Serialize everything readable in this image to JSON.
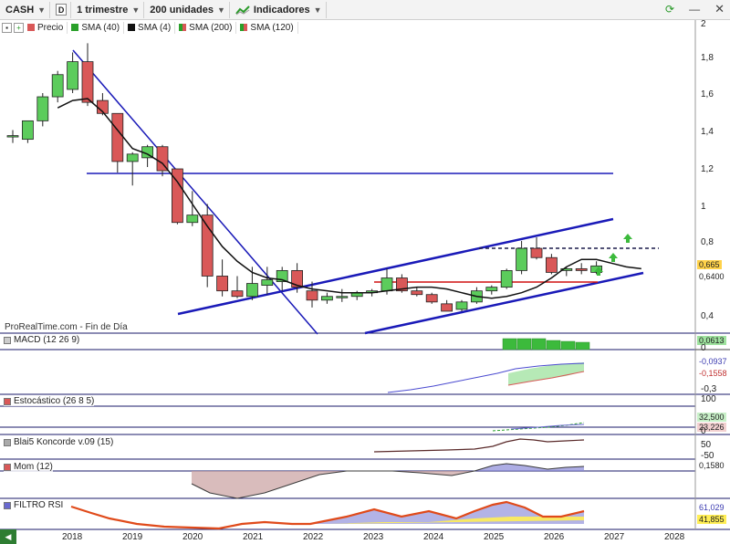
{
  "toolbar": {
    "ticker": "CASH",
    "period_box": "D",
    "timeframe": "1 trimestre",
    "units": "200 unidades",
    "indicators": "Indicadores"
  },
  "legend": {
    "price": "Precio",
    "sma40": "SMA (40)",
    "sma4": "SMA (4)",
    "sma200": "SMA (200)",
    "sma120": "SMA (120)"
  },
  "watermark": "ProRealTime.com - Fin de Día",
  "panels": {
    "macd": "MACD (12 26 9)",
    "stoch": "Estocástico (26 8 5)",
    "koncorde": "Blai5 Koncorde v.09 (15)",
    "mom": "Mom (12)",
    "rsi": "FILTRO RSI"
  },
  "price_axis": [
    "2",
    "1,8",
    "1,6",
    "1,4",
    "1,2",
    "1",
    "0,8",
    "0,4"
  ],
  "price_tags": {
    "last": "0,665",
    "sma": "0,6400"
  },
  "macd_axis": {
    "tag1": "0,0613",
    "v1": "0",
    "tag2": "-0,0937",
    "tag3": "-0,1558",
    "v2": "-0,3"
  },
  "stoch_axis": {
    "v1": "100",
    "tag1": "32,500",
    "tag2": "23,226",
    "v2": "0"
  },
  "koncorde_axis": {
    "v1": "50",
    "v2": "-50"
  },
  "mom_axis": {
    "tag1": "0,1580"
  },
  "rsi_axis": {
    "tag1": "61,029",
    "tag2": "41,855"
  },
  "years": [
    "2018",
    "2019",
    "2020",
    "2021",
    "2022",
    "2023",
    "2024",
    "2025",
    "2026",
    "2027",
    "2028"
  ],
  "colors": {
    "up": "#5ccc5c",
    "down": "#d95858",
    "trend": "#1a1ab8",
    "support": "#d01010"
  },
  "candles": [
    {
      "o": 1.37,
      "h": 1.4,
      "l": 1.33,
      "c": 1.37
    },
    {
      "o": 1.35,
      "h": 1.45,
      "l": 1.33,
      "c": 1.45
    },
    {
      "o": 1.45,
      "h": 1.6,
      "l": 1.42,
      "c": 1.58
    },
    {
      "o": 1.58,
      "h": 1.72,
      "l": 1.55,
      "c": 1.7
    },
    {
      "o": 1.62,
      "h": 1.82,
      "l": 1.6,
      "c": 1.77
    },
    {
      "o": 1.77,
      "h": 1.87,
      "l": 1.53,
      "c": 1.55
    },
    {
      "o": 1.56,
      "h": 1.6,
      "l": 1.48,
      "c": 1.49
    },
    {
      "o": 1.49,
      "h": 1.49,
      "l": 1.17,
      "c": 1.23
    },
    {
      "o": 1.23,
      "h": 1.28,
      "l": 1.1,
      "c": 1.27
    },
    {
      "o": 1.25,
      "h": 1.32,
      "l": 1.2,
      "c": 1.31
    },
    {
      "o": 1.31,
      "h": 1.32,
      "l": 1.15,
      "c": 1.18
    },
    {
      "o": 1.19,
      "h": 1.19,
      "l": 0.89,
      "c": 0.9
    },
    {
      "o": 0.9,
      "h": 1.07,
      "l": 0.88,
      "c": 0.94
    },
    {
      "o": 0.94,
      "h": 1.0,
      "l": 0.55,
      "c": 0.61
    },
    {
      "o": 0.61,
      "h": 0.7,
      "l": 0.5,
      "c": 0.53
    },
    {
      "o": 0.53,
      "h": 0.61,
      "l": 0.49,
      "c": 0.5
    },
    {
      "o": 0.5,
      "h": 0.66,
      "l": 0.48,
      "c": 0.57
    },
    {
      "o": 0.56,
      "h": 0.66,
      "l": 0.51,
      "c": 0.59
    },
    {
      "o": 0.58,
      "h": 0.66,
      "l": 0.53,
      "c": 0.64
    },
    {
      "o": 0.64,
      "h": 0.68,
      "l": 0.52,
      "c": 0.55
    },
    {
      "o": 0.53,
      "h": 0.58,
      "l": 0.44,
      "c": 0.48
    },
    {
      "o": 0.48,
      "h": 0.52,
      "l": 0.46,
      "c": 0.5
    },
    {
      "o": 0.5,
      "h": 0.54,
      "l": 0.47,
      "c": 0.5
    },
    {
      "o": 0.5,
      "h": 0.53,
      "l": 0.48,
      "c": 0.52
    },
    {
      "o": 0.52,
      "h": 0.54,
      "l": 0.5,
      "c": 0.53
    },
    {
      "o": 0.53,
      "h": 0.65,
      "l": 0.51,
      "c": 0.6
    },
    {
      "o": 0.6,
      "h": 0.62,
      "l": 0.52,
      "c": 0.53
    },
    {
      "o": 0.53,
      "h": 0.55,
      "l": 0.5,
      "c": 0.51
    },
    {
      "o": 0.51,
      "h": 0.52,
      "l": 0.46,
      "c": 0.47
    },
    {
      "o": 0.46,
      "h": 0.48,
      "l": 0.42,
      "c": 0.42
    },
    {
      "o": 0.43,
      "h": 0.48,
      "l": 0.42,
      "c": 0.47
    },
    {
      "o": 0.47,
      "h": 0.55,
      "l": 0.46,
      "c": 0.53
    },
    {
      "o": 0.53,
      "h": 0.56,
      "l": 0.51,
      "c": 0.55
    },
    {
      "o": 0.55,
      "h": 0.65,
      "l": 0.54,
      "c": 0.64
    },
    {
      "o": 0.64,
      "h": 0.8,
      "l": 0.62,
      "c": 0.76
    },
    {
      "o": 0.76,
      "h": 0.82,
      "l": 0.7,
      "c": 0.71
    },
    {
      "o": 0.71,
      "h": 0.73,
      "l": 0.62,
      "c": 0.63
    },
    {
      "o": 0.64,
      "h": 0.66,
      "l": 0.61,
      "c": 0.65
    },
    {
      "o": 0.65,
      "h": 0.68,
      "l": 0.62,
      "c": 0.64
    },
    {
      "o": 0.63,
      "h": 0.69,
      "l": 0.62,
      "c": 0.665
    }
  ],
  "sma4": [
    1.52,
    1.56,
    1.57,
    1.5,
    1.4,
    1.3,
    1.27,
    1.22,
    1.12,
    1.0,
    0.88,
    0.77,
    0.69,
    0.63,
    0.6,
    0.59,
    0.56,
    0.54,
    0.53,
    0.52,
    0.52,
    0.52,
    0.53,
    0.54,
    0.55,
    0.55,
    0.54,
    0.52,
    0.5,
    0.49,
    0.5,
    0.52,
    0.55,
    0.6,
    0.66,
    0.7,
    0.7,
    0.68,
    0.66,
    0.65
  ],
  "sma4_start": 4
}
